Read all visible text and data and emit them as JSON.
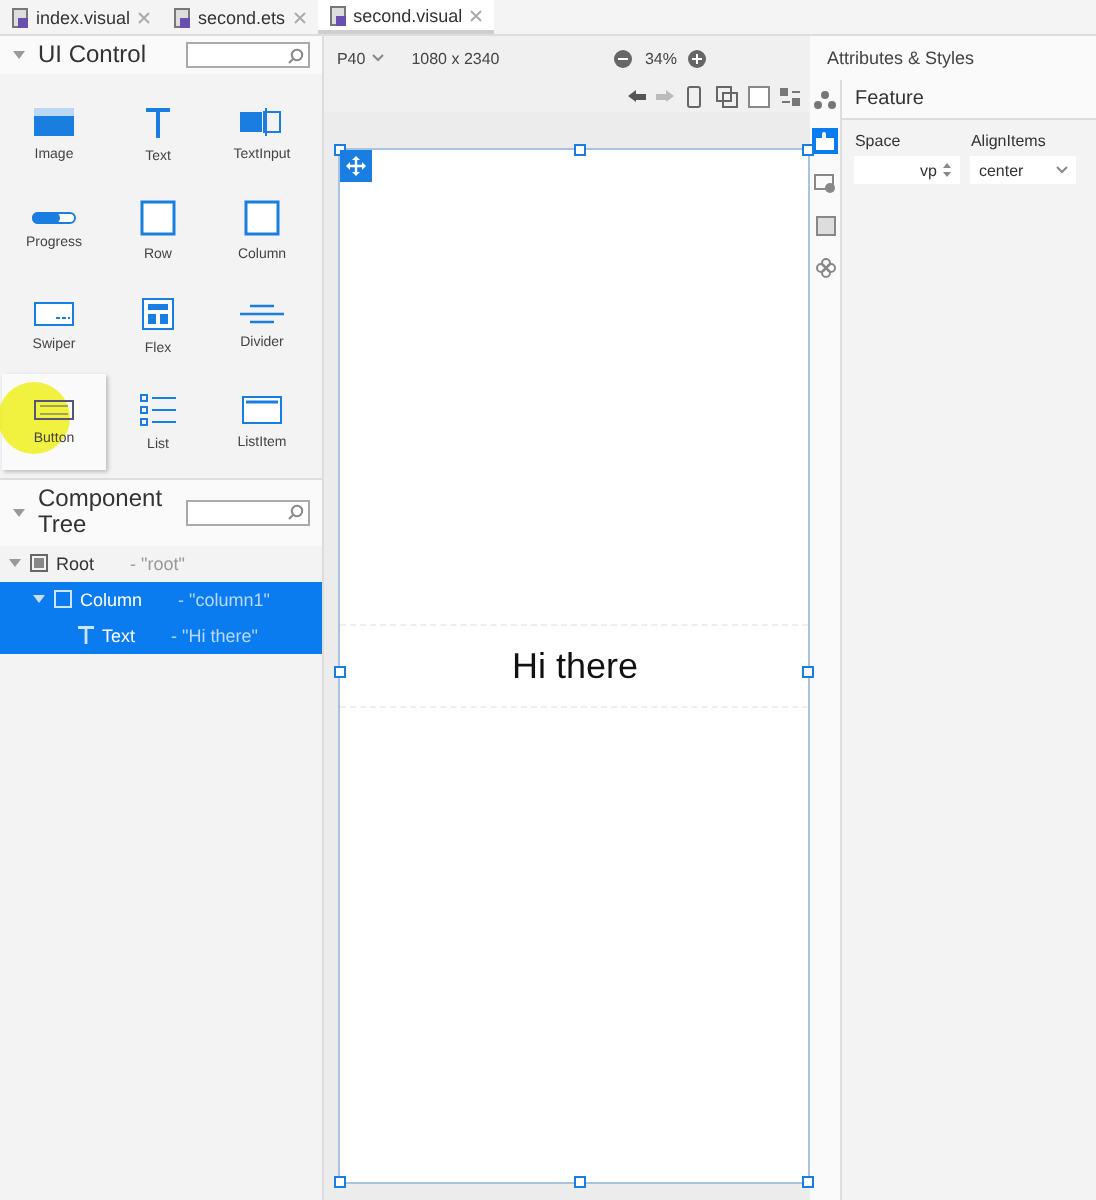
{
  "tabs": [
    {
      "label": "index.visual",
      "selected": false
    },
    {
      "label": "second.ets",
      "selected": false
    },
    {
      "label": "second.visual",
      "selected": true
    }
  ],
  "ui_control": {
    "title": "UI Control",
    "items": [
      {
        "kind": "image",
        "label": "Image",
        "selected": false
      },
      {
        "kind": "text",
        "label": "Text",
        "selected": false
      },
      {
        "kind": "textinput",
        "label": "TextInput",
        "selected": false
      },
      {
        "kind": "progress",
        "label": "Progress",
        "selected": false
      },
      {
        "kind": "row",
        "label": "Row",
        "selected": false
      },
      {
        "kind": "column",
        "label": "Column",
        "selected": false
      },
      {
        "kind": "swiper",
        "label": "Swiper",
        "selected": false
      },
      {
        "kind": "flex",
        "label": "Flex",
        "selected": false
      },
      {
        "kind": "divider",
        "label": "Divider",
        "selected": false
      },
      {
        "kind": "button",
        "label": "Button",
        "selected": true
      },
      {
        "kind": "list",
        "label": "List",
        "selected": false
      },
      {
        "kind": "listitem",
        "label": "ListItem",
        "selected": false
      }
    ]
  },
  "component_tree": {
    "title": "Component Tree",
    "nodes": [
      {
        "kind": "root",
        "label": "Root",
        "id_text": "- \"root\"",
        "selected": false,
        "expanded": true,
        "children": [
          {
            "kind": "column",
            "label": "Column",
            "id_text": "- \"column1\"",
            "selected": true,
            "expanded": true,
            "children": [
              {
                "kind": "text",
                "label": "Text",
                "id_text": "- \"Hi there\"",
                "selected": true,
                "expanded": false
              }
            ]
          }
        ]
      }
    ]
  },
  "canvas": {
    "device": "P40",
    "resolution": "1080 x 2340",
    "zoom": "34%",
    "preview_text": "Hi there"
  },
  "attributes": {
    "title": "Attributes & Styles",
    "section": "Feature",
    "fields": [
      {
        "label": "Space",
        "value": "vp",
        "kind": "spinner"
      },
      {
        "label": "AlignItems",
        "value": "center",
        "kind": "dropdown"
      }
    ]
  }
}
